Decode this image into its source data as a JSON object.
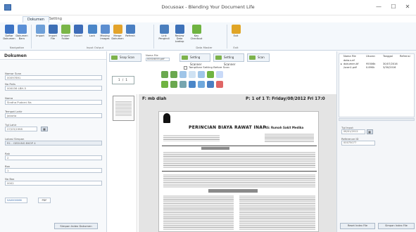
{
  "window": {
    "title": "Docusoax - Blending Your Document Life",
    "minimize": "—",
    "maximize": "☐",
    "close": "✕"
  },
  "ribbon": {
    "tabs": [
      "Dokumen",
      "Setting"
    ],
    "buttons": [
      {
        "label": "Daftar Dokumen",
        "color": "#3c73c4"
      },
      {
        "label": "Dokumen Baru",
        "color": "#5a8fd6"
      },
      {
        "label": "Import",
        "color": "#6d9fd8"
      },
      {
        "label": "Import File",
        "color": "#3e6fb5"
      },
      {
        "label": "Import Folder",
        "color": "#7ab648"
      },
      {
        "label": "Export",
        "color": "#3d6cb8"
      },
      {
        "label": "Lock",
        "color": "#4a86c8"
      },
      {
        "label": "Missing Images",
        "color": "#5c8ed0"
      },
      {
        "label": "Merge Dokumen",
        "color": "#e3a32a"
      },
      {
        "label": "Refresh",
        "color": "#4a7fc2"
      },
      {
        "label": "Link Pengindi",
        "color": "#4b7fbe"
      },
      {
        "label": "Review Data Lookup",
        "color": "#3e72b9"
      },
      {
        "label": "Key Checkout",
        "color": "#6fb341"
      },
      {
        "label": "Exit",
        "color": "#e0a526"
      }
    ],
    "groups": [
      "Navigation",
      "Input Output",
      "Data Master",
      "Exit"
    ]
  },
  "left_panel": {
    "header": "Dokumen",
    "fields": [
      {
        "label": "Nomor Scan",
        "value": "00097891"
      },
      {
        "label": "No Polis",
        "value": "000036 LBH-5"
      },
      {
        "label": "Nama",
        "value": "Sindha Pudarni Ns"
      },
      {
        "label": "Tempat Lahir",
        "value": "Jakarta"
      },
      {
        "label": "Tgl Lahir",
        "value": "27/03/1998"
      },
      {
        "label": "Lokasi Simpan",
        "value": "R1 - GEDUNG BKOP 4"
      },
      {
        "label": "Rak",
        "value": "2"
      },
      {
        "label": "Box",
        "value": "1"
      },
      {
        "label": "No Box",
        "value": "0002"
      }
    ],
    "file_badge": "SA0000066",
    "file_ext": "PDF",
    "save_button": "Simpan Index Dokumen"
  },
  "center": {
    "toolbar": {
      "snap_scan": "Snap Scan",
      "zoom_label": "Nama File",
      "zoom_value": "00016055.pdf",
      "scan_btn1": "Setting Scanner",
      "scan_btn2": "Setting Scanner",
      "scan_btn3": "Scan",
      "checkbox_label": "Tampilkan Setting Before Scan"
    },
    "nav_box": "1 / 1",
    "viewer": {
      "filename": "F: mb dlah",
      "page_info": "P: 1 of 1   T: Friday/08/2012 Fri 17:0",
      "doc_title": "PERINCIAN BIAYA RAWAT INAP",
      "hospital": "RS: Rumah Sakit Medika"
    }
  },
  "right_panel": {
    "columns": [
      "Nama File",
      "Ukuran",
      "Tanggal",
      "Refrensi"
    ],
    "rows": [
      [
        "data.s.ef",
        "",
        "",
        ""
      ],
      [
        "dokumen.tif",
        "95506k",
        "30/07/2016",
        ""
      ],
      [
        "/scan1.pdf",
        "0.890k",
        "3/30/2016",
        ""
      ]
    ],
    "fields": [
      {
        "label": "Tgl Input",
        "value": "08/01/2012"
      },
      {
        "label": "Reference ID",
        "value": "00075077"
      }
    ],
    "buttons": [
      "Reset Index File",
      "Simpan Index File"
    ]
  }
}
